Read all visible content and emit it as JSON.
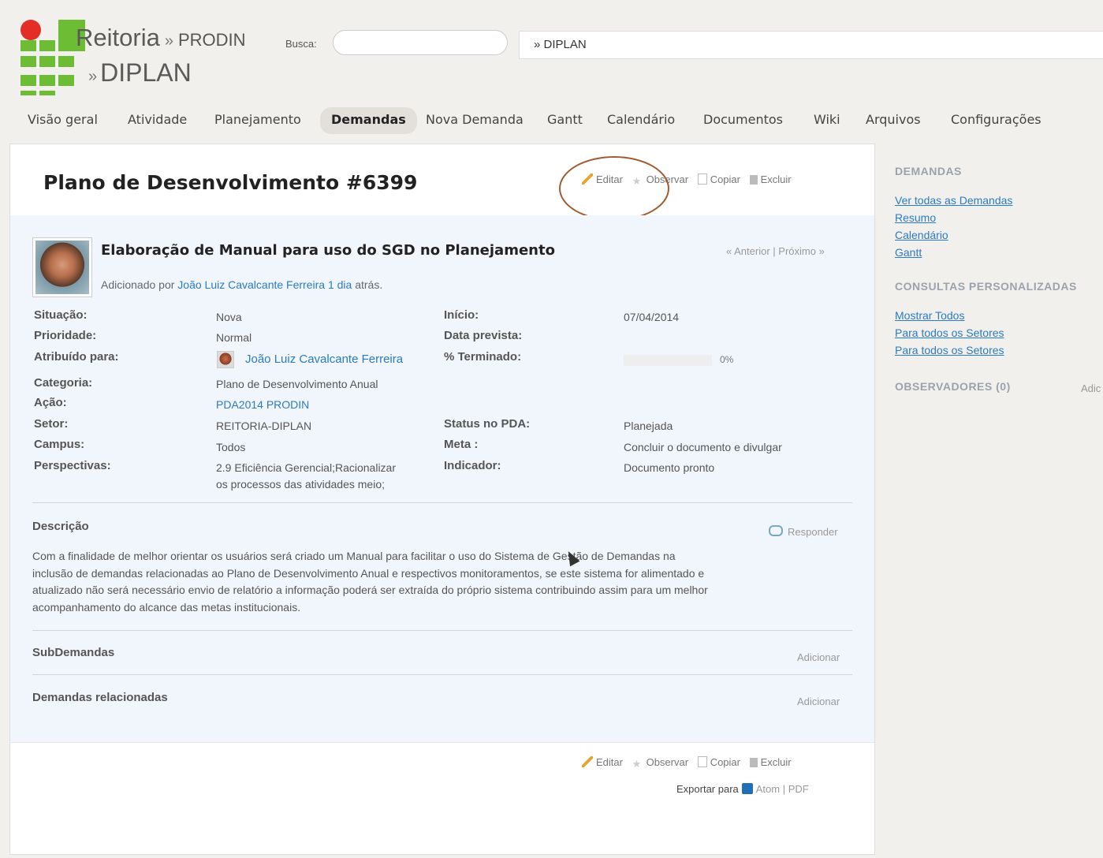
{
  "header": {
    "title_main": "Reitoria",
    "title_sep": "»",
    "title_parent": "PRODIN",
    "title_sub": "DIPLAN",
    "busca_label": "Busca:",
    "search_placeholder": "",
    "project_selector": "» DIPLAN"
  },
  "tabs": [
    {
      "label": "Visão geral"
    },
    {
      "label": "Atividade"
    },
    {
      "label": "Planejamento"
    },
    {
      "label": "Demandas"
    },
    {
      "label": "Nova Demanda"
    },
    {
      "label": "Gantt"
    },
    {
      "label": "Calendário"
    },
    {
      "label": "Documentos"
    },
    {
      "label": "Wiki"
    },
    {
      "label": "Arquivos"
    },
    {
      "label": "Configurações"
    }
  ],
  "actions": {
    "edit": "Editar",
    "watch": "Observar",
    "copy": "Copiar",
    "delete": "Excluir"
  },
  "issue": {
    "title": "Plano de Desenvolvimento #6399",
    "subject": "Elaboração de Manual para uso do SGD no Planejamento",
    "added_by_prefix": "Adicionado por",
    "author": "João Luiz Cavalcante Ferreira",
    "time_ago": "1 dia",
    "time_suffix": "atrás.",
    "prev": "« Anterior",
    "sep": "|",
    "next": "Próximo »",
    "attributes": {
      "situacao_label": "Situação:",
      "situacao": "Nova",
      "prioridade_label": "Prioridade:",
      "prioridade": "Normal",
      "atribuido_label": "Atribuído para:",
      "atribuido": "João Luiz Cavalcante Ferreira",
      "categoria_label": "Categoria:",
      "categoria": "Plano de Desenvolvimento Anual",
      "acao_label": "Ação:",
      "acao": "PDA2014 PRODIN",
      "setor_label": "Setor:",
      "setor": "REITORIA-DIPLAN",
      "campus_label": "Campus:",
      "campus": "Todos",
      "perspectivas_label": "Perspectivas:",
      "perspectivas_1": "2.9 Eficiência Gerencial;Racionalizar",
      "perspectivas_2": "os processos das atividades meio;",
      "inicio_label": "Início:",
      "inicio": "07/04/2014",
      "data_prevista_label": "Data prevista:",
      "data_prevista": "",
      "terminado_label": "% Terminado:",
      "terminado": "0%",
      "terminado_fraction": 0,
      "status_pda_label": "Status no PDA:",
      "status_pda": "Planejada",
      "meta_label": "Meta :",
      "meta": "Concluir o documento e divulgar",
      "indicador_label": "Indicador:",
      "indicador": "Documento pronto"
    },
    "description_title": "Descrição",
    "reply": "Responder",
    "description_lines": [
      "Com a finalidade de melhor orientar os usuários será criado um Manual para facilitar o uso do Sistema de Gestão de Demandas na",
      "inclusão de demandas relacionadas ao Plano de Desenvolvimento Anual e respectivos monitoramentos, se este sistema for alimentado e",
      "atualizado não será necessário envio de relatório a informação poderá ser extraída do próprio sistema contribuindo assim para um melhor",
      "acompanhamento do alcance das metas institucionais."
    ],
    "subtasks_title": "SubDemandas",
    "related_title": "Demandas relacionadas",
    "add": "Adicionar"
  },
  "export": {
    "label": "Exportar para",
    "atom": "Atom",
    "sep": "|",
    "pdf": "PDF"
  },
  "sidebar": {
    "demandas_title": "DEMANDAS",
    "demandas_links": [
      "Ver todas as Demandas",
      "Resumo",
      "Calendário",
      "Gantt"
    ],
    "consultas_title": "CONSULTAS PERSONALIZADAS",
    "consultas_links": [
      "Mostrar Todos",
      "Para todos os Setores",
      "Para todos os Setores"
    ],
    "observadores_title": "OBSERVADORES (0)",
    "observadores_add": "Adic"
  },
  "colors": {
    "logo_green": "#6cbd33",
    "logo_red": "#e52d27",
    "link": "#2a7bc4",
    "annotation_circle": "#a05b30"
  }
}
